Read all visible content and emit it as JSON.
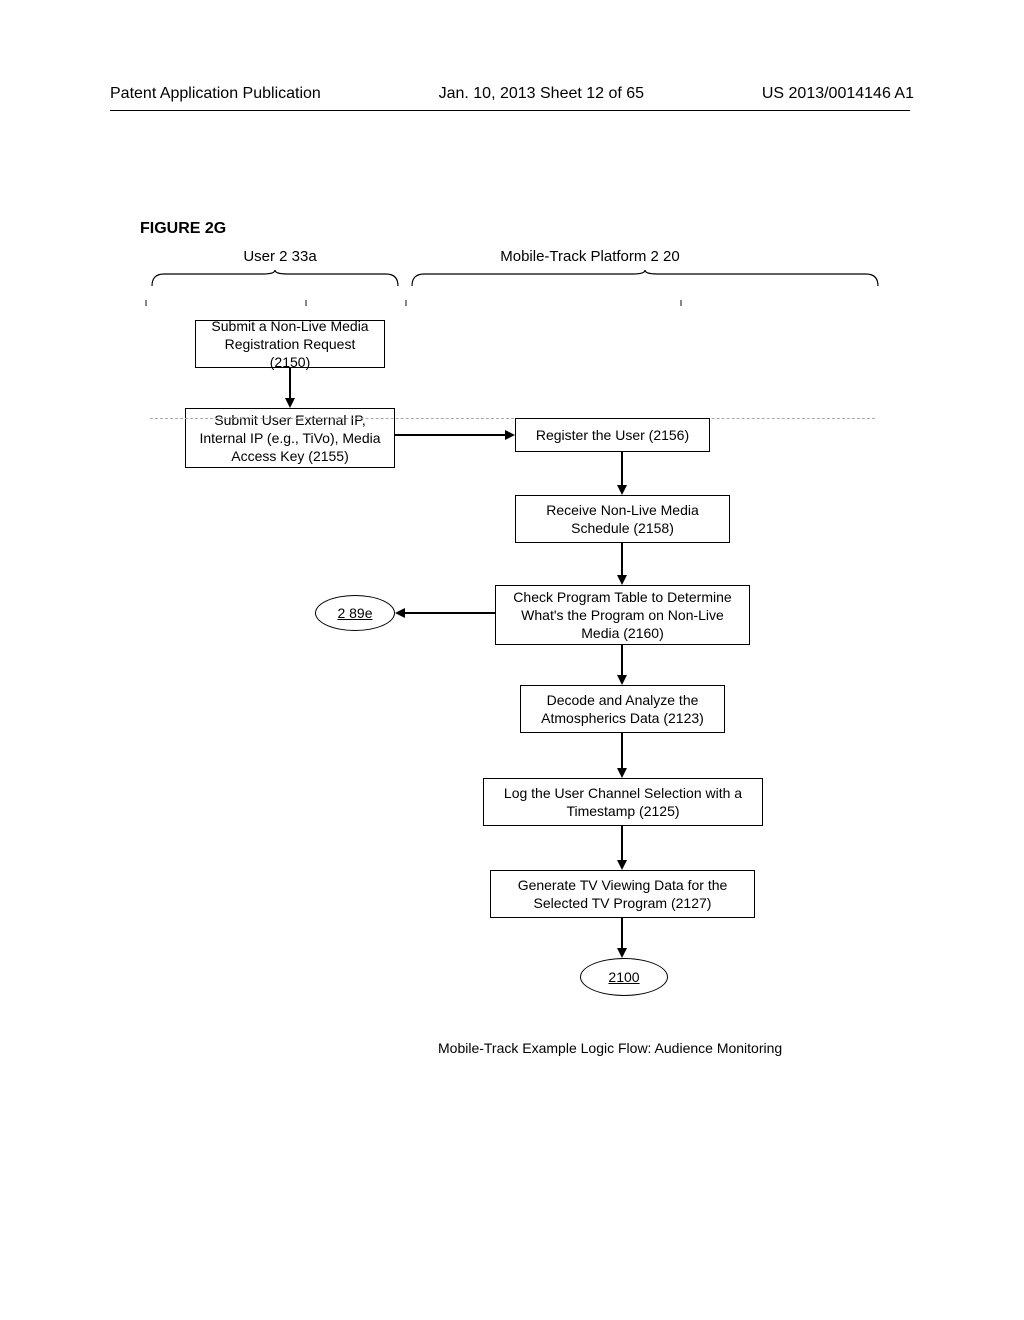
{
  "header": {
    "left": "Patent Application Publication",
    "center": "Jan. 10, 2013  Sheet 12 of 65",
    "right": "US 2013/0014146 A1"
  },
  "figure_label": "FIGURE 2G",
  "columns": {
    "user": "User 2 33a",
    "platform": "Mobile-Track  Platform 2 20"
  },
  "boxes": {
    "b2150": "Submit a Non-Live Media Registration Request (2150)",
    "b2155": "Submit User External IP, Internal IP (e.g., TiVo), Media Access Key (2155)",
    "b2156": "Register the User (2156)",
    "b2158": "Receive Non-Live Media Schedule (2158)",
    "b2160": "Check Program Table to Determine What's the Program on Non-Live Media (2160)",
    "b2123": "Decode and Analyze the Atmospherics Data (2123)",
    "b2125": "Log the User Channel Selection with a Timestamp  (2125)",
    "b2127": "Generate TV Viewing Data for the Selected TV Program (2127)"
  },
  "ellipses": {
    "e289e": "2 89e",
    "e2100": "2100"
  },
  "caption": "Mobile-Track Example Logic Flow: Audience Monitoring"
}
